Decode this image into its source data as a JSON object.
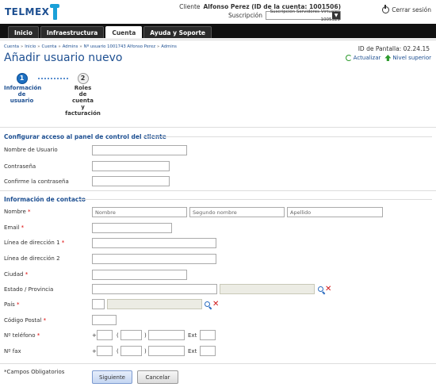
{
  "header": {
    "logo_text": "TELMEX",
    "client_label": "Cliente",
    "client_value": "Alfonso Perez (ID de la cuenta: 1001506)",
    "subscription_label": "Suscripción",
    "subscription_value": "Suscripción Servidores Virtuales 1005329",
    "logout_label": "Cerrar sesión"
  },
  "nav": {
    "tabs": [
      {
        "label": "Inicio",
        "active": false
      },
      {
        "label": "Infraestructura",
        "active": false
      },
      {
        "label": "Cuenta",
        "active": true
      },
      {
        "label": "Ayuda y Soporte",
        "active": false
      }
    ]
  },
  "breadcrumb": [
    "Cuenta",
    "Inicio",
    "Cuenta",
    "Admins",
    "Nº usuario 1001743 Alfonso Perez",
    "Admins"
  ],
  "screen_id": "ID de Pantalla:  02.24.15",
  "page_title": "Añadir usuario nuevo",
  "top_links": {
    "refresh": "Actualizar",
    "up": "Nivel superior"
  },
  "steps": [
    {
      "number": "1",
      "lines": [
        "Información",
        "de",
        "usuario"
      ]
    },
    {
      "number": "2",
      "lines": [
        "Roles",
        "de",
        "cuenta",
        "y",
        "facturación"
      ]
    }
  ],
  "sections": {
    "access": "Configurar acceso al panel de control del cliente",
    "contact": "Información de contacto"
  },
  "labels": {
    "username": "Nombre de Usuario",
    "password": "Contraseña",
    "confirm_password": "Confirme la contraseña",
    "name": "Nombre",
    "email": "Email",
    "address1": "Línea de dirección 1",
    "address2": "Línea de dirección 2",
    "city": "Ciudad",
    "state": "Estado / Provincia",
    "country": "País",
    "postal": "Código Postal",
    "phone": "Nº teléfono",
    "fax": "Nº fax",
    "required_mark": "*",
    "plus": "+",
    "paren_open": "(",
    "paren_close": ")",
    "ext": "Ext"
  },
  "placeholders": {
    "first_name": "Nombre",
    "middle_name": "Segundo nombre",
    "last_name": "Apellido"
  },
  "footer": {
    "required_note": "*Campos Obligatorios",
    "next_label": "Siguiente",
    "cancel_label": "Cancelar"
  },
  "colors": {
    "brand": "#1d4f91",
    "nav_bg": "#111111",
    "required": "#dd0000",
    "accent_green": "#2e9b2e"
  }
}
